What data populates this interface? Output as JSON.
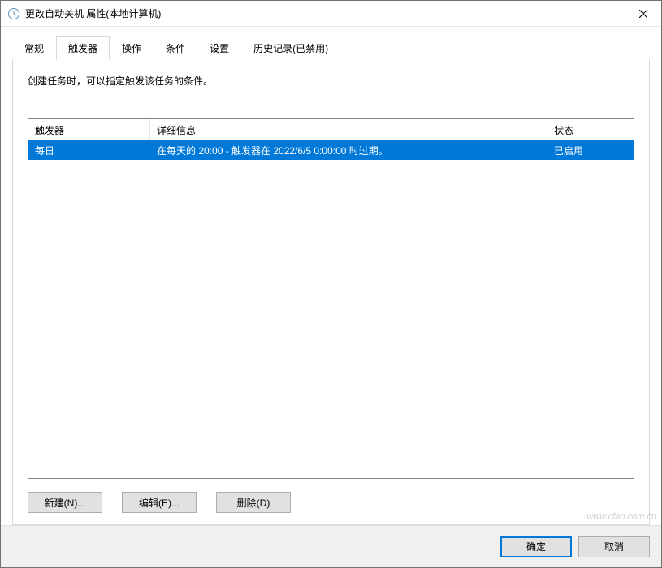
{
  "window": {
    "title": "更改自动关机 属性(本地计算机)"
  },
  "tabs": [
    {
      "label": "常规"
    },
    {
      "label": "触发器"
    },
    {
      "label": "操作"
    },
    {
      "label": "条件"
    },
    {
      "label": "设置"
    },
    {
      "label": "历史记录(已禁用)"
    }
  ],
  "active_tab_index": 1,
  "tabpage": {
    "instructions": "创建任务时，可以指定触发该任务的条件。",
    "columns": {
      "trigger": "触发器",
      "detail": "详细信息",
      "status": "状态"
    },
    "rows": [
      {
        "trigger": "每日",
        "detail": "在每天的 20:00 - 触发器在 2022/6/5 0:00:00 时过期。",
        "status": "已启用",
        "selected": true
      }
    ],
    "buttons": {
      "new": "新建(N)...",
      "edit": "编辑(E)...",
      "delete": "删除(D)"
    }
  },
  "footer": {
    "ok": "确定",
    "cancel": "取消"
  },
  "watermark": "www.cfan.com.cn"
}
